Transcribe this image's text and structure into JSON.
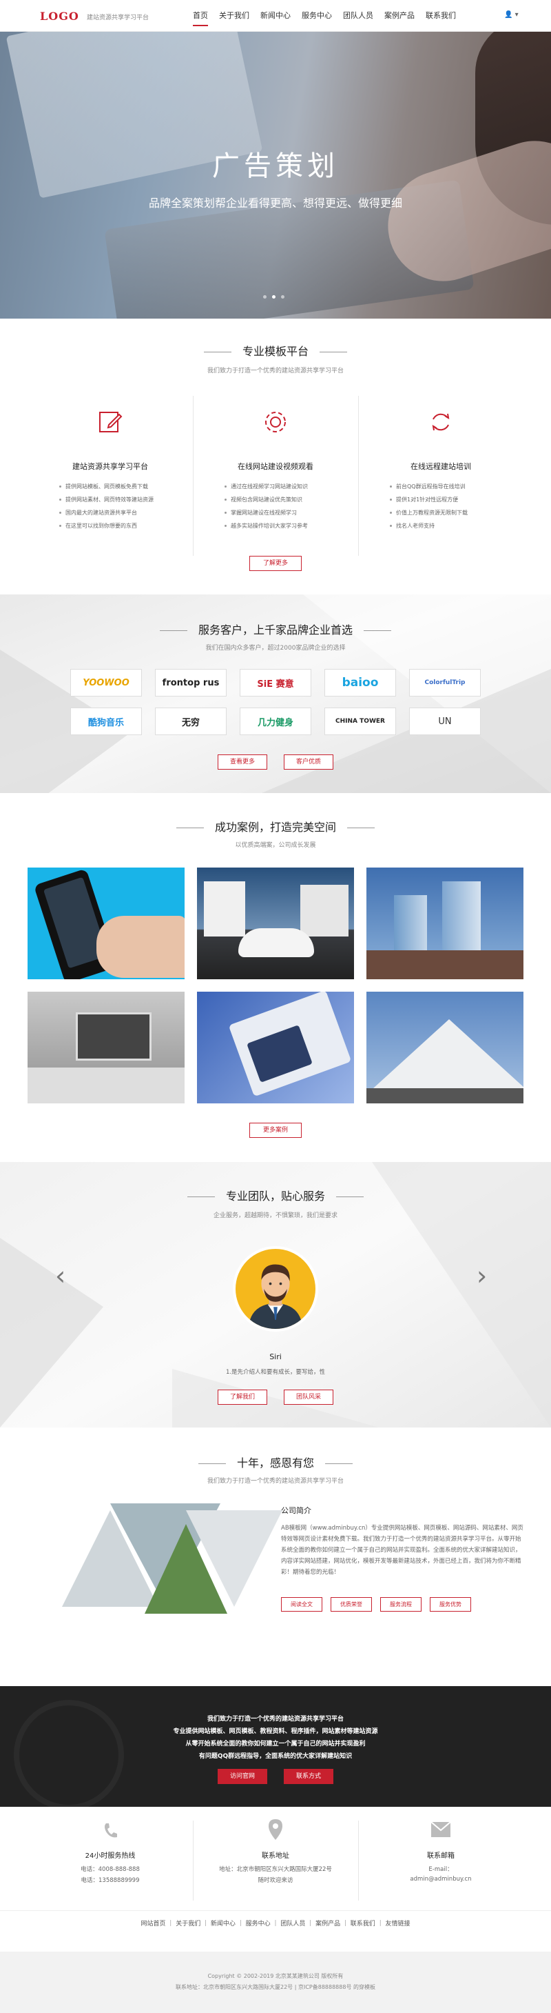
{
  "header": {
    "logo": "LOGO",
    "tagline": "建站资源共享学习平台",
    "nav": [
      "首页",
      "关于我们",
      "新闻中心",
      "服务中心",
      "团队人员",
      "案例产品",
      "联系我们"
    ],
    "user": "👤 ▾"
  },
  "hero": {
    "title": "广告策划",
    "subtitle": "品牌全案策划帮企业看得更高、想得更远、做得更细"
  },
  "platform": {
    "title": "专业模板平台",
    "subtitle": "我们致力于打造一个优秀的建站资源共享学习平台",
    "columns": [
      {
        "title": "建站资源共享学习平台",
        "items": [
          "提供网站模板、网页模板免费下载",
          "提供网站素材、网页特效等建站资源",
          "国内最大的建站资源共享平台",
          "在这里可以找到你想要的东西"
        ]
      },
      {
        "title": "在线网站建设视频观看",
        "items": [
          "通过在线视频学习网站建设知识",
          "视频包含网站建设优先策知识",
          "掌握网站建设在线视频学习",
          "越多实站操作培训大家学习参考"
        ]
      },
      {
        "title": "在线远程建站培训",
        "items": [
          "前台QQ群远程指导在线培训",
          "提供1对1针对性远程方便",
          "价值上万教程资源无限制下载",
          "找名人老师支持"
        ]
      }
    ],
    "button": "了解更多"
  },
  "clients": {
    "title": "服务客户，上千家品牌企业首选",
    "subtitle": "我们在国内众多客户，超过2000家品牌企业的选择",
    "logos": [
      "YOOWOO",
      "frontop rus",
      "SiE 赛意",
      "baioo",
      "ColorfulTrip",
      "酷狗音乐",
      "无穷",
      "几力健身",
      "CHINA TOWER",
      "UN"
    ],
    "buttons": [
      "查看更多",
      "客户优质"
    ]
  },
  "cases": {
    "title": "成功案例，打造完美空间",
    "subtitle": "以优质高端案，公司成长发展",
    "button": "更多案例"
  },
  "team": {
    "title": "专业团队，贴心服务",
    "subtitle": "企业服务，超越期待，不惧繁琐，我们是要求",
    "name": "Siri",
    "desc": "1.是先介绍人和要有成长，要写给，性",
    "buttons": [
      "了解我们",
      "团队风采"
    ]
  },
  "about": {
    "title": "十年，感恩有您",
    "subtitle": "我们致力于打造一个优秀的建站资源共享学习平台",
    "heading": "公司简介",
    "text": "AB模板网（www.adminbuy.cn）专业提供网站模板、网页模板、网站源码、网站素材、网页特效等网页设计素材免费下载。我们致力于打造一个优秀的建站资源共享学习平台。从零开始系统全面的教你如何建立一个属于自己的网站并实现盈利。全面系统的优大家详解建站知识，内容详实网站搭建，网站优化，模板开发等最新建站技术，外面已经上百，我们将为你不断精彩！期待着您的光临！",
    "buttons": [
      "阅读全文",
      "优质荣誉",
      "服务流程",
      "服务优势"
    ]
  },
  "banner": {
    "lines": [
      "我们致力于打造一个优秀的建站资源共享学习平台",
      "专业提供网站模板、网页模板、教程资料、程序插件，网站素材等建站资源",
      "从零开始系统全面的教你如何建立一个属于自己的网站并实现盈利",
      "有问题QQ群远程指导，全面系统的优大家详解建站知识"
    ],
    "buttons": [
      "访问官网",
      "联系方式"
    ]
  },
  "contact": [
    {
      "title": "24小时服务热线",
      "lines": [
        "电话：4008-888-888",
        "电话：13588889999"
      ]
    },
    {
      "title": "联系地址",
      "lines": [
        "地址：北京市朝阳区东兴大路国际大厦22号",
        "随时欢迎来访"
      ]
    },
    {
      "title": "联系邮箱",
      "lines": [
        "E-mail：",
        "admin@adminbuy.cn"
      ]
    }
  ],
  "footer": {
    "links": "网站首页 ｜ 关于我们 ｜ 新闻中心 ｜ 服务中心 ｜ 团队人员 ｜ 案例产品 ｜ 联系我们 ｜ 友情链接",
    "copyright": "Copyright © 2002-2019 北京某某建筑公司 版权所有",
    "address": "联系地址：北京市朝阳区东兴大路国际大厦22号 | 京ICP备88888888号 的穿模板"
  },
  "colors": {
    "accent": "#c8202e",
    "dark": "#222222"
  }
}
